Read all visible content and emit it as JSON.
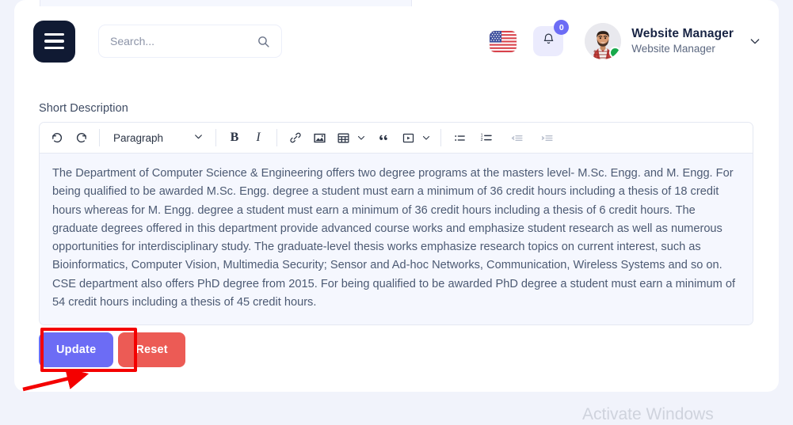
{
  "header": {
    "menu_icon": "hamburger-icon",
    "search": {
      "placeholder": "Search...",
      "value": "",
      "icon": "search-icon"
    },
    "language_flag": "us-flag-icon",
    "notifications": {
      "icon": "bell-icon",
      "count": "0"
    },
    "user": {
      "name": "Website Manager",
      "role": "Website Manager",
      "status": "online",
      "chevron_icon": "chevron-down-icon"
    }
  },
  "form": {
    "short_description_label": "Short Description",
    "editor": {
      "toolbar": {
        "undo_label": "Undo",
        "redo_label": "Redo",
        "block_format": "Paragraph",
        "bold_label": "B",
        "italic_label": "I",
        "link_label": "Link",
        "image_label": "Image",
        "table_label": "Table",
        "blockquote_label": "Blockquote",
        "media_label": "Media",
        "bullet_list_label": "Bulleted list",
        "numbered_list_label": "Numbered list",
        "outdent_label": "Decrease indent",
        "indent_label": "Increase indent"
      },
      "content": "The Department of Computer Science & Engineering offers two degree programs at the masters level- M.Sc. Engg. and M. Engg. For being qualified to be awarded M.Sc. Engg. degree a student must earn a minimum of 36 credit hours including a thesis of 18 credit hours whereas for M. Engg. degree a student must earn a minimum of 36 credit hours including a thesis of 6 credit hours. The graduate degrees offered in this department provide advanced course works and emphasize student research as well as numerous opportunities for interdisciplinary study. The graduate-level thesis works emphasize research topics on current interest, such as Bioinformatics, Computer Vision, Multimedia Security; Sensor and Ad-hoc Networks, Communication, Wireless Systems and so on. CSE department also offers PhD degree from 2015. For being qualified to be awarded PhD degree a student must earn a minimum of 54 credit hours including a thesis of 45 credit hours."
    },
    "update_button": "Update",
    "reset_button": "Reset"
  },
  "annotation": {
    "highlight_target": "update-button",
    "color": "#f40000"
  },
  "watermark": "Activate Windows",
  "colors": {
    "page_background": "#f1f3fb",
    "primary": "#6c6cf5",
    "danger": "#ec5b55",
    "dark": "#101a33",
    "editor_body_bg": "#f5f7fe",
    "annotation_red": "#f40000",
    "status_green": "#18a94b"
  }
}
